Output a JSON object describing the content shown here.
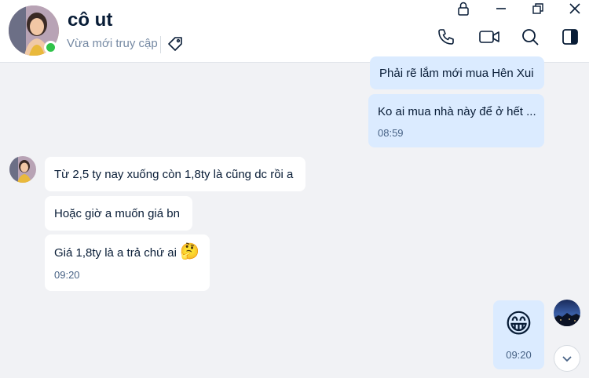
{
  "header": {
    "contact_name": "cô ut",
    "status": "Vừa mới truy cập"
  },
  "messages": [
    {
      "sender": "me",
      "text": "Phải rẽ lắm mới mua Hên Xui"
    },
    {
      "sender": "me",
      "text": "Ko ai mua nhà này để ở hết ...",
      "time": "08:59"
    },
    {
      "sender": "them",
      "text": "Từ 2,5 ty nay xuống còn 1,8ty là cũng dc rồi a"
    },
    {
      "sender": "them",
      "text": "Hoặc giờ a muốn giá bn"
    },
    {
      "sender": "them",
      "text": "Giá 1,8ty là a trả chứ ai",
      "emoji": "🤔",
      "time": "09:20"
    },
    {
      "sender": "me",
      "emoji": "😁",
      "time": "09:20"
    }
  ],
  "icons": {
    "lock": "lock-icon",
    "minimize": "minimize-icon",
    "restore": "restore-icon",
    "close": "close-icon",
    "call": "phone-icon",
    "video": "video-camera-icon",
    "search": "search-icon",
    "panel": "sidebar-toggle-icon",
    "tag": "tag-icon",
    "scroll_down": "chevron-down-icon"
  },
  "colors": {
    "bubble_me": "#dbebff",
    "bubble_them": "#ffffff",
    "background": "#f1f2f5",
    "online": "#30c34a"
  }
}
